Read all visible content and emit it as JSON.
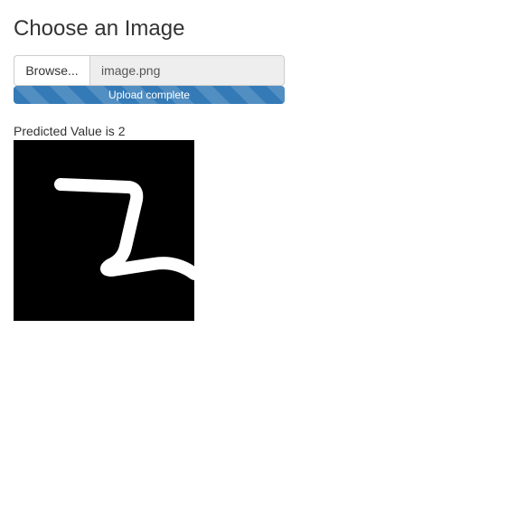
{
  "header": {
    "title": "Choose an Image"
  },
  "file_input": {
    "browse_label": "Browse...",
    "file_name": "image.png"
  },
  "upload": {
    "status": "Upload complete",
    "progress_percent": 100,
    "bar_color": "#337ab7"
  },
  "result": {
    "prediction": "Predicted Value is 2"
  }
}
